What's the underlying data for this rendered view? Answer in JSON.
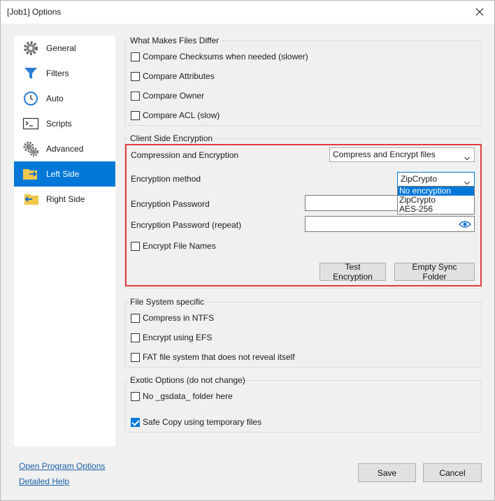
{
  "window": {
    "title": "[Job1] Options"
  },
  "sidebar": {
    "items": [
      {
        "label": "General",
        "icon": "gear-icon"
      },
      {
        "label": "Filters",
        "icon": "filter-icon"
      },
      {
        "label": "Auto",
        "icon": "clock-icon"
      },
      {
        "label": "Scripts",
        "icon": "terminal-icon"
      },
      {
        "label": "Advanced",
        "icon": "gears-icon"
      },
      {
        "label": "Left Side",
        "icon": "folder-arrow-right-icon",
        "active": true
      },
      {
        "label": "Right Side",
        "icon": "folder-arrow-left-icon"
      }
    ]
  },
  "differ": {
    "title": "What Makes Files Differ",
    "options": [
      {
        "label": "Compare Checksums when needed (slower)",
        "checked": false
      },
      {
        "label": "Compare Attributes",
        "checked": false
      },
      {
        "label": "Compare Owner",
        "checked": false
      },
      {
        "label": "Compare ACL (slow)",
        "checked": false
      }
    ]
  },
  "encryption": {
    "title": "Client Side Encryption",
    "compression_label": "Compression and Encryption",
    "compression_value": "Compress and Encrypt files",
    "method_label": "Encryption method",
    "method_value": "ZipCrypto",
    "method_options": [
      "No encryption",
      "ZipCrypto",
      "AES-256"
    ],
    "method_highlighted": "No encryption",
    "password_label": "Encryption Password",
    "password_repeat_label": "Encryption Password (repeat)",
    "password_value": "",
    "password_repeat_value": "",
    "encrypt_names_label": "Encrypt File Names",
    "encrypt_names_checked": false,
    "test_button": "Test Encryption",
    "empty_button": "Empty Sync Folder"
  },
  "filesystem": {
    "title": "File System specific",
    "options": [
      {
        "label": "Compress in NTFS",
        "checked": false
      },
      {
        "label": "Encrypt using EFS",
        "checked": false
      },
      {
        "label": "FAT file system that does not reveal itself",
        "checked": false
      }
    ]
  },
  "exotic": {
    "title": "Exotic Options (do not change)",
    "options": [
      {
        "label": "No _gsdata_ folder here",
        "checked": false
      },
      {
        "label": "Safe Copy using temporary files",
        "checked": true
      }
    ]
  },
  "footer": {
    "open_program_options": "Open Program Options",
    "detailed_help": "Detailed Help",
    "save": "Save",
    "cancel": "Cancel"
  },
  "colors": {
    "accent": "#0078d7",
    "highlight_border": "#e03c3c",
    "link": "#1c5fa8"
  }
}
